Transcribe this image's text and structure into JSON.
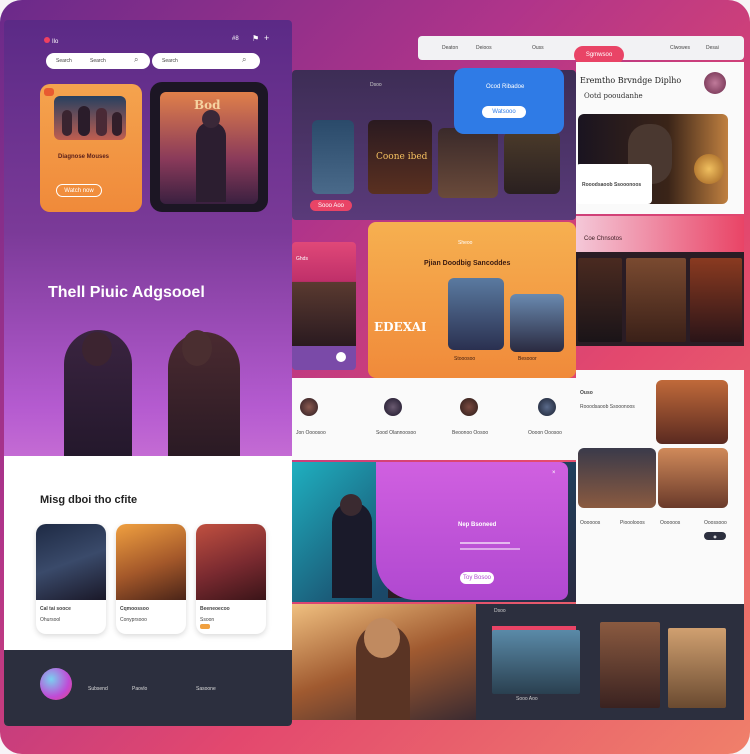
{
  "colors": {
    "purple": "#6a2a8a",
    "magenta": "#c04bd6",
    "orange": "#f4a34e",
    "blue": "#2f7be6",
    "pink_button": "#e94466",
    "dark_footer": "#2c2f3e"
  },
  "left": {
    "logo_text": "Ilo",
    "top_icons": [
      "flag-icon",
      "plus-icon"
    ],
    "top_label": "#8",
    "search": {
      "label_a": "Search",
      "label_b": "Search",
      "label_c": "Search"
    },
    "hero_card": {
      "title": "Diagnose Mouses",
      "button": "Watch now"
    },
    "poster_title": "Bod",
    "headline": "Thell Piuic Adgsooel",
    "section_title": "Misg dboi tho cfite",
    "cards": [
      {
        "title": "Cal tai sooce",
        "subtitle": "Ohursool",
        "color": "#2a3a5a"
      },
      {
        "title": "Cqmoossoo",
        "subtitle": "Conyprsooo",
        "color": "#a4582a"
      },
      {
        "title": "Beeneoecoo",
        "subtitle": "Ssoon",
        "color": "#7a2a30"
      }
    ],
    "footer_links": [
      "Subsend",
      "Paovlo",
      "Sasoone"
    ]
  },
  "right": {
    "topbar": {
      "items": [
        "Deaton",
        "Deioos",
        "Ouss"
      ],
      "pink_button": "Sgmwsoo",
      "links": [
        "Clwowes",
        "Desai"
      ]
    },
    "featured_card": {
      "title": "Eremtho Brvndge Diplho",
      "subtitle": "Ootd pooudanhe"
    },
    "blue_card": {
      "title": "Ocod Ribadoe",
      "button": "Watsooo"
    },
    "mid_strip_title": "Coone ibed",
    "orange_card": {
      "label": "Sheoo",
      "title": "Pjian Doodbig Sancoddes",
      "word": "EDEXAI",
      "tags": [
        "Stooosoo",
        "Besooor"
      ]
    },
    "pink_side_label": "Ghds",
    "pink_panel_label": "Coe Chnsotos",
    "avatars": [
      {
        "name": "Jon Oooosoo"
      },
      {
        "name": "Sood Olannoosoo"
      },
      {
        "name": "Beoonoo Oosoo"
      },
      {
        "name": "Oooon Ooosoo"
      }
    ],
    "gallery_label": "Ouso",
    "gallery_sub": "Rooodsaoob Ssooonoos",
    "purple_card": {
      "title": "Nep Bsoneed",
      "button": "Toy Bosoo"
    },
    "bottom_labels": [
      "Oooooos",
      "Piooolooos",
      "Oooooos",
      "Ooossooo"
    ],
    "bottom_strip": {
      "label": "Dsoo",
      "caption": "Sooo Aoo"
    }
  }
}
